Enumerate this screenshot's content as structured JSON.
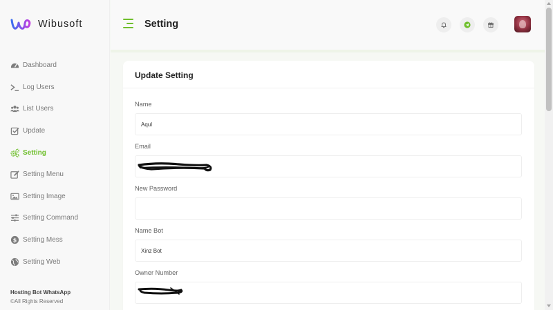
{
  "brand": {
    "name": "Wibusoft"
  },
  "header": {
    "title": "Setting"
  },
  "sidebar": {
    "items": [
      {
        "label": "Dashboard",
        "icon": "dashboard-icon"
      },
      {
        "label": "Log Users",
        "icon": "terminal-icon"
      },
      {
        "label": "List Users",
        "icon": "users-icon"
      },
      {
        "label": "Update",
        "icon": "check-square-icon"
      },
      {
        "label": "Setting",
        "icon": "cogs-icon",
        "active": true
      },
      {
        "label": "Setting Menu",
        "icon": "edit-icon"
      },
      {
        "label": "Setting Image",
        "icon": "image-icon"
      },
      {
        "label": "Setting Command",
        "icon": "sliders-icon"
      },
      {
        "label": "Setting Mess",
        "icon": "dollar-circle-icon"
      },
      {
        "label": "Setting Web",
        "icon": "globe-icon"
      }
    ],
    "footer": {
      "title": "Hosting Bot WhatsApp",
      "copyright": "©All Rights Reserved"
    }
  },
  "form": {
    "title": "Update Setting",
    "fields": [
      {
        "label": "Name",
        "value": "Aqul"
      },
      {
        "label": "Email",
        "value": ""
      },
      {
        "label": "New Password",
        "value": ""
      },
      {
        "label": "Name Bot",
        "value": "Xinz Bot"
      },
      {
        "label": "Owner Number",
        "value": ""
      }
    ]
  },
  "colors": {
    "accent": "#6fbf2c",
    "brand_gradient": [
      "#3c6df0",
      "#c23fe0"
    ]
  }
}
